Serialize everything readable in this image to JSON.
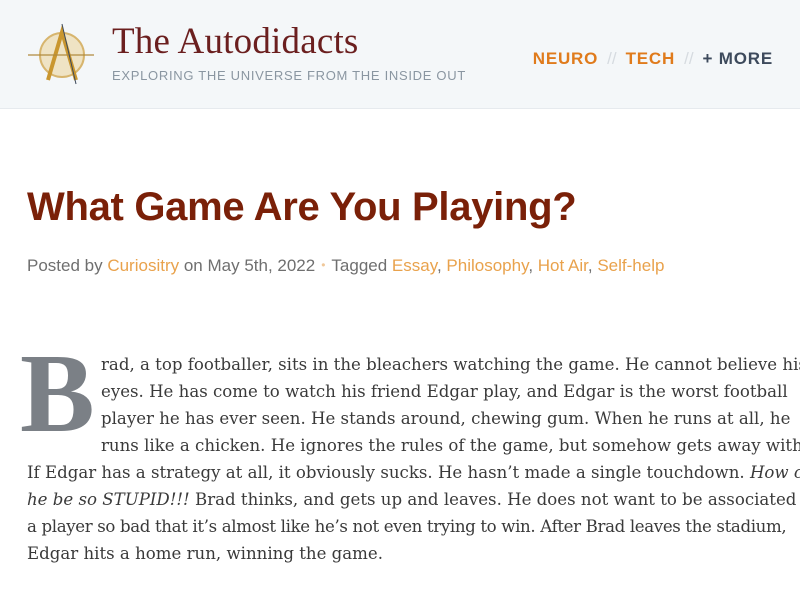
{
  "site": {
    "title": "The Autodidacts",
    "tagline": "EXPLORING THE UNIVERSE FROM THE INSIDE OUT"
  },
  "nav": {
    "items": [
      {
        "label": "NEURO"
      },
      {
        "label": "TECH"
      },
      {
        "label": "+ MORE"
      }
    ],
    "separator": "//"
  },
  "post": {
    "title": "What Game Are You Playing?",
    "meta": {
      "posted_by_prefix": "Posted by ",
      "author": "Curiositry",
      "date_text": " on May 5th, 2022",
      "dot": "•",
      "tagged_prefix": "Tagged ",
      "tags": [
        "Essay",
        "Philosophy",
        "Hot Air",
        "Self-help"
      ],
      "comma": ", "
    },
    "dropcap": "B",
    "lines": [
      "rad, a top footballer, sits in the bleachers watching the game. He cannot believe his",
      "eyes. He has come to watch his friend Edgar play, and Edgar is the worst football",
      "player he has ever seen. He stands around, chewing gum. When he runs at all, he",
      "runs like a chicken. He ignores the rules of the game, but somehow gets away with it.",
      "If Edgar has a strategy at all, it obviously sucks. He hasn’t made a single touchdown. ",
      "How could",
      "he be so STUPID!!!",
      " Brad thinks, and gets up and leaves. He does not want to be associated with",
      "a player so bad that it’s almost like he’s not even trying to win. After Brad leaves the stadium,",
      "Edgar hits a home run, winning the game."
    ]
  },
  "colors": {
    "accent": "#e07b1c",
    "title": "#7a2008",
    "link": "#e9a24c"
  },
  "icons": {
    "logo": "autodidacts-logo-icon"
  }
}
